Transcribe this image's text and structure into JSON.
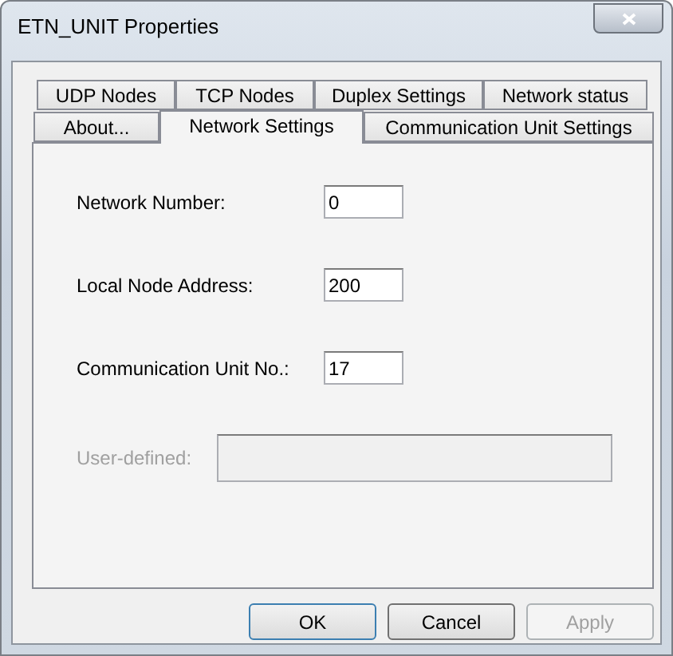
{
  "window": {
    "title": "ETN_UNIT Properties"
  },
  "tab_rows": [
    [
      {
        "label": "UDP Nodes",
        "selected": false
      },
      {
        "label": "TCP Nodes",
        "selected": false
      },
      {
        "label": "Duplex Settings",
        "selected": false
      },
      {
        "label": "Network status",
        "selected": false
      }
    ],
    [
      {
        "label": "About...",
        "selected": false
      },
      {
        "label": "Network Settings",
        "selected": true
      },
      {
        "label": "Communication Unit Settings",
        "selected": false
      }
    ]
  ],
  "fields": [
    {
      "label": "Network Number:",
      "value": "0",
      "disabled": false,
      "kind": "short"
    },
    {
      "label": "Local Node Address:",
      "value": "200",
      "disabled": false,
      "kind": "short"
    },
    {
      "label": "Communication Unit No.:",
      "value": "17",
      "disabled": false,
      "kind": "short"
    },
    {
      "label": "User-defined:",
      "disabled": true,
      "kind": "wide"
    }
  ],
  "buttons": [
    {
      "label": "OK",
      "disabled": false,
      "default": true
    },
    {
      "label": "Cancel",
      "disabled": false,
      "default": false
    },
    {
      "label": "Apply",
      "disabled": true,
      "default": false
    }
  ]
}
